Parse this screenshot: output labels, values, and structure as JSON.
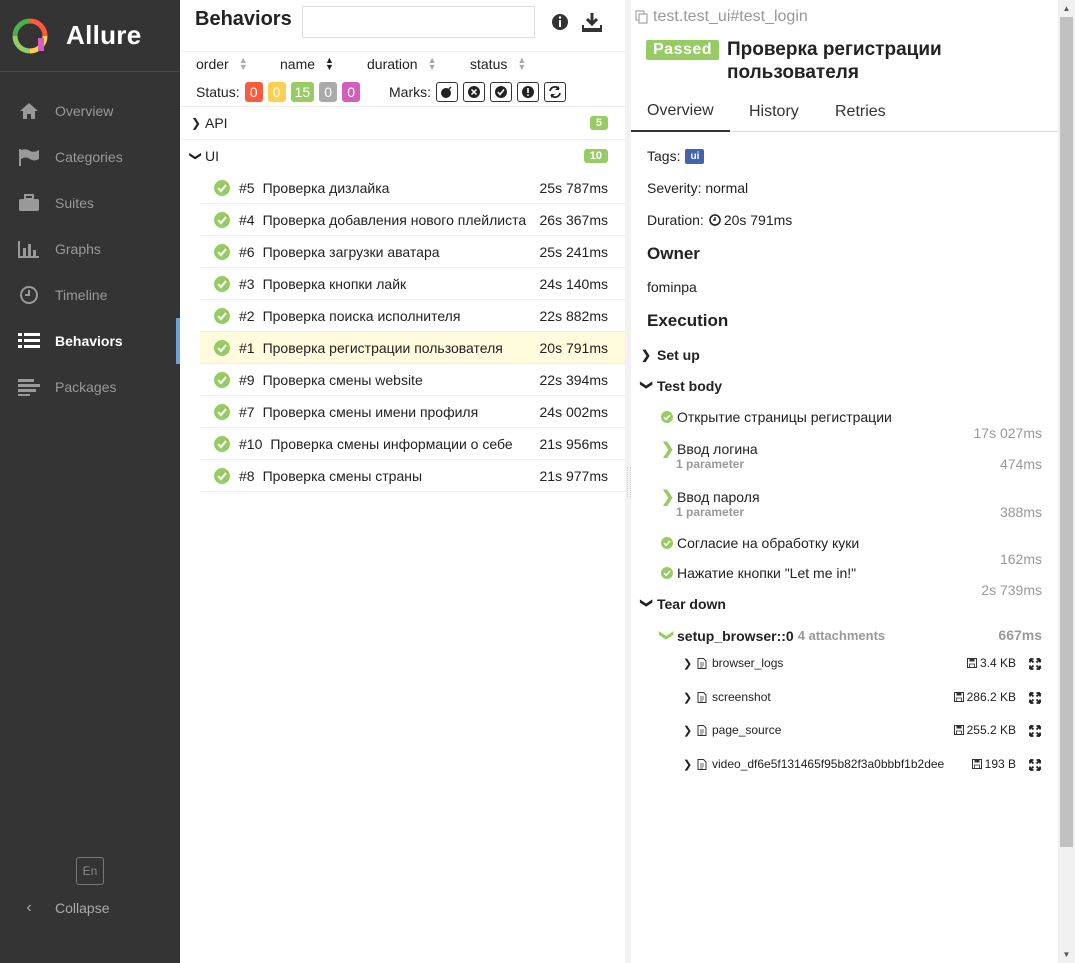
{
  "app": {
    "name": "Allure"
  },
  "sidebar": {
    "items": [
      {
        "label": "Overview",
        "icon": "home-icon"
      },
      {
        "label": "Categories",
        "icon": "flag-icon"
      },
      {
        "label": "Suites",
        "icon": "briefcase-icon"
      },
      {
        "label": "Graphs",
        "icon": "bar-chart-icon"
      },
      {
        "label": "Timeline",
        "icon": "clock-icon"
      },
      {
        "label": "Behaviors",
        "icon": "list-icon",
        "active": true
      },
      {
        "label": "Packages",
        "icon": "align-left-icon"
      }
    ],
    "lang": "En",
    "collapse": "Collapse"
  },
  "behaviors": {
    "title": "Behaviors",
    "search_placeholder": "",
    "sort": {
      "order": "order",
      "name": "name",
      "duration": "duration",
      "status": "status"
    },
    "status_label": "Status:",
    "status_counts": [
      {
        "value": "0",
        "color": "#fd5a3e"
      },
      {
        "value": "0",
        "color": "#ffd050"
      },
      {
        "value": "15",
        "color": "#97cc64"
      },
      {
        "value": "0",
        "color": "#aaaaaa"
      },
      {
        "value": "0",
        "color": "#d35ebe"
      }
    ],
    "marks_label": "Marks:",
    "groups": [
      {
        "name": "API",
        "count": "5",
        "expanded": false
      },
      {
        "name": "UI",
        "count": "10",
        "expanded": true
      }
    ],
    "tests": [
      {
        "num": "#5",
        "name": "Проверка дизлайка",
        "duration": "25s 787ms"
      },
      {
        "num": "#4",
        "name": "Проверка добавления нового плейлиста",
        "duration": "26s 367ms"
      },
      {
        "num": "#6",
        "name": "Проверка загрузки аватара",
        "duration": "25s 241ms"
      },
      {
        "num": "#3",
        "name": "Проверка кнопки лайк",
        "duration": "24s 140ms"
      },
      {
        "num": "#2",
        "name": "Проверка поиска исполнителя",
        "duration": "22s 882ms"
      },
      {
        "num": "#1",
        "name": "Проверка регистрации пользователя",
        "duration": "20s 791ms",
        "selected": true
      },
      {
        "num": "#9",
        "name": "Проверка смены website",
        "duration": "22s 394ms"
      },
      {
        "num": "#7",
        "name": "Проверка смены имени профиля",
        "duration": "24s 002ms"
      },
      {
        "num": "#10",
        "name": "Проверка смены информации о себе",
        "duration": "21s 956ms"
      },
      {
        "num": "#8",
        "name": "Проверка смены страны",
        "duration": "21s 977ms"
      }
    ]
  },
  "detail": {
    "breadcrumb": "test.test_ui#test_login",
    "status": "Passed",
    "title": "Проверка регистрации пользователя",
    "tabs": [
      "Overview",
      "History",
      "Retries"
    ],
    "tags_label": "Tags:",
    "tag": "ui",
    "severity": "Severity: normal",
    "duration_label": "Duration:",
    "duration": "20s 791ms",
    "owner_heading": "Owner",
    "owner": "fominpa",
    "execution_heading": "Execution",
    "setup": "Set up",
    "test_body": "Test body",
    "steps": [
      {
        "name": "Открытие страницы регистрации",
        "duration": "17s 027ms",
        "type": "ok"
      },
      {
        "name": "Ввод логина",
        "param": "1 parameter",
        "duration": "474ms",
        "type": "expand"
      },
      {
        "name": "Ввод пароля",
        "param": "1 parameter",
        "duration": "388ms",
        "type": "expand"
      },
      {
        "name": "Согласие на обработку куки",
        "duration": "162ms",
        "type": "ok"
      },
      {
        "name": "Нажатие кнопки \"Let me in!\"",
        "duration": "2s 739ms",
        "type": "ok"
      }
    ],
    "tear_down": "Tear down",
    "fixture": {
      "name": "setup_browser::0",
      "attachments": "4 attachments",
      "duration": "667ms"
    },
    "attachments": [
      {
        "name": "browser_logs",
        "size": "3.4 KB",
        "icon": "text-file-icon"
      },
      {
        "name": "screenshot",
        "size": "286.2 KB",
        "icon": "image-file-icon"
      },
      {
        "name": "page_source",
        "size": "255.2 KB",
        "icon": "code-file-icon"
      },
      {
        "name": "video_df6e5f131465f95b82f3a0bbbf1b2dee",
        "size": "193 B",
        "icon": "video-file-icon"
      }
    ]
  }
}
